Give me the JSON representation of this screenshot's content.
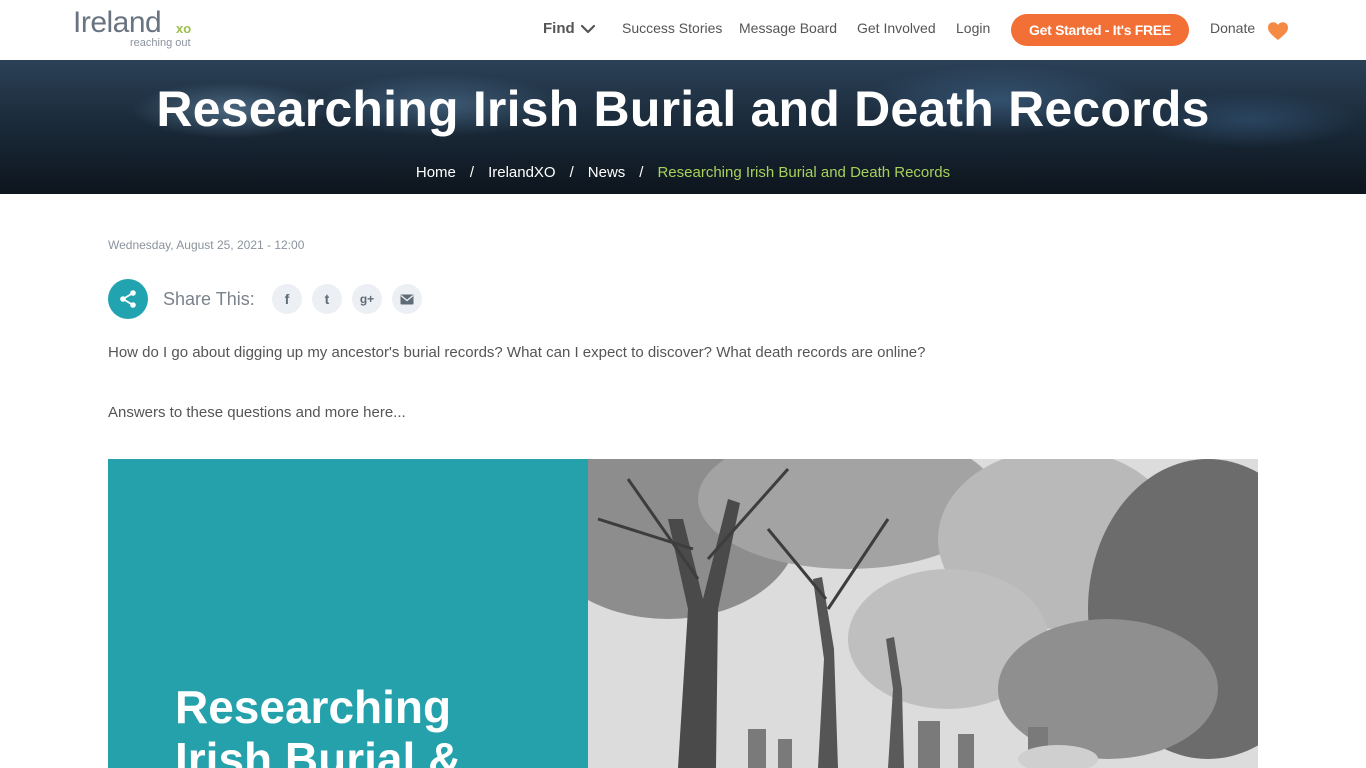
{
  "header": {
    "logo_main": "Ireland",
    "logo_xo": "xo",
    "logo_tagline": "reaching out",
    "nav": {
      "find": "Find",
      "success_stories": "Success Stories",
      "message_board": "Message Board",
      "get_involved": "Get Involved",
      "login": "Login",
      "cta": "Get Started - It's FREE",
      "donate": "Donate"
    }
  },
  "hero": {
    "title": "Researching Irish Burial and Death Records",
    "breadcrumb": [
      "Home",
      "IrelandXO",
      "News",
      "Researching Irish Burial and Death Records"
    ]
  },
  "article": {
    "date": "Wednesday, August 25, 2021 - 12:00",
    "share_label": "Share This:",
    "social": {
      "facebook": "f",
      "twitter": "t",
      "googleplus": "g+",
      "email": "email-icon"
    },
    "paragraphs": [
      "How do I go about digging up my ancestor's burial records? What can I expect to discover? What death records are online?",
      "Answers to these questions and more here..."
    ],
    "feature_text_lines": [
      "Researching",
      "Irish Burial &"
    ]
  },
  "colors": {
    "accent_orange": "#f26f35",
    "teal": "#22a3b0",
    "breadcrumb_current": "#a7d15a",
    "logo_green": "#9cc04a"
  }
}
